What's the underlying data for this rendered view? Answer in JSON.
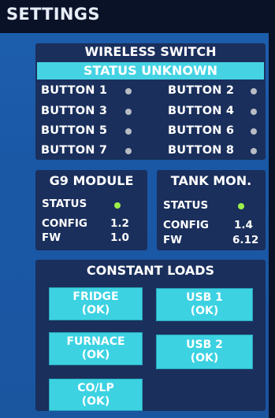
{
  "header": {
    "title": "SETTINGS"
  },
  "wireless_switch": {
    "title": "WIRELESS SWITCH",
    "status": "STATUS UNKNOWN",
    "buttons": [
      {
        "label": "BUTTON 1",
        "state_color": "#b8bcc4"
      },
      {
        "label": "BUTTON 2",
        "state_color": "#b8bcc4"
      },
      {
        "label": "BUTTON 3",
        "state_color": "#b8bcc4"
      },
      {
        "label": "BUTTON 4",
        "state_color": "#b8bcc4"
      },
      {
        "label": "BUTTON 5",
        "state_color": "#b8bcc4"
      },
      {
        "label": "BUTTON 6",
        "state_color": "#b8bcc4"
      },
      {
        "label": "BUTTON 7",
        "state_color": "#b8bcc4"
      },
      {
        "label": "BUTTON 8",
        "state_color": "#b8bcc4"
      }
    ]
  },
  "g9_module": {
    "title": "G9 MODULE",
    "status_label": "STATUS",
    "status_color": "#9cf24a",
    "config_label": "CONFIG",
    "config_value": "1.2",
    "fw_label": "FW",
    "fw_value": "1.0"
  },
  "tank_mon": {
    "title": "TANK MON.",
    "status_label": "STATUS",
    "status_color": "#9cf24a",
    "config_label": "CONFIG",
    "config_value": "1.4",
    "fw_label": "FW",
    "fw_value": "6.12"
  },
  "constant_loads": {
    "title": "CONSTANT LOADS",
    "loads": [
      {
        "name": "FRIDGE",
        "state": "(OK)"
      },
      {
        "name": "USB 1",
        "state": "(OK)"
      },
      {
        "name": "FURNACE",
        "state": "(OK)"
      },
      {
        "name": "USB 2",
        "state": "(OK)"
      },
      {
        "name": "CO/LP",
        "state": "(OK)"
      }
    ]
  },
  "colors": {
    "background": "#1d5fae",
    "panel": "#1a2f5c",
    "accent_cyan": "#45d3e4",
    "status_ok": "#9cf24a",
    "status_unknown": "#b8bcc4"
  }
}
